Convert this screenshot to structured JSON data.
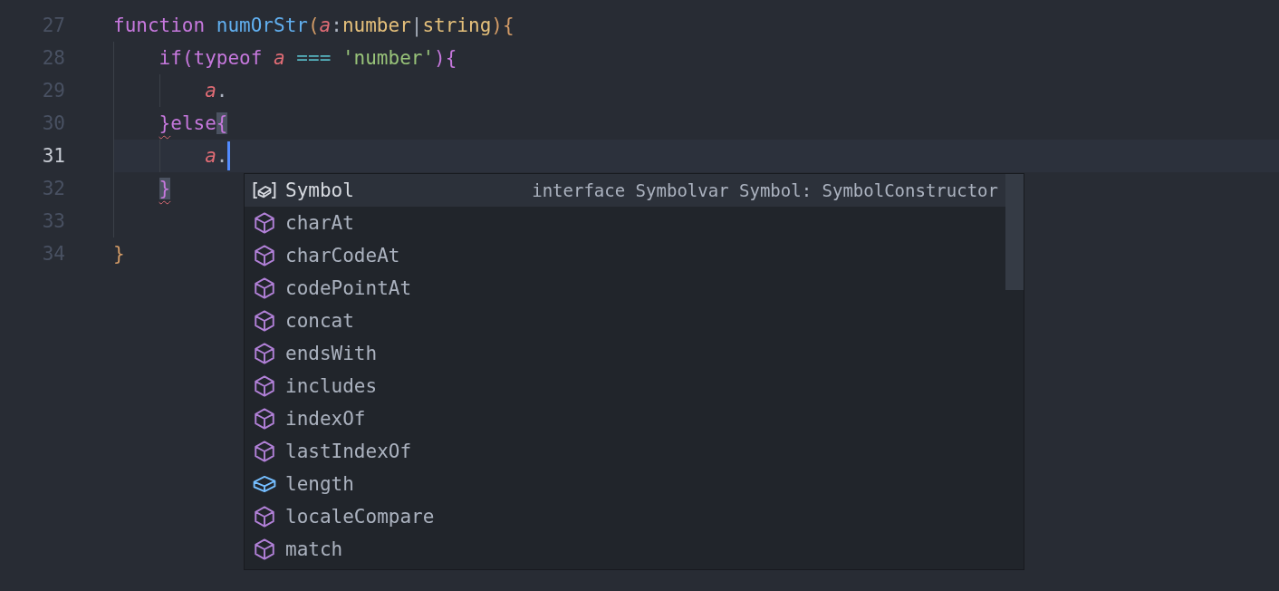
{
  "editor": {
    "lines": [
      {
        "number": "27",
        "current": false,
        "tokens": [
          {
            "text": "function ",
            "kind": "keyword"
          },
          {
            "text": "numOrStr",
            "kind": "function"
          },
          {
            "text": "(",
            "kind": "bracket1"
          },
          {
            "text": "a",
            "kind": "param"
          },
          {
            "text": ":",
            "kind": "punct"
          },
          {
            "text": "number",
            "kind": "type"
          },
          {
            "text": "|",
            "kind": "punct"
          },
          {
            "text": "string",
            "kind": "type"
          },
          {
            "text": ")",
            "kind": "bracket1"
          },
          {
            "text": "{",
            "kind": "bracket1"
          }
        ]
      },
      {
        "number": "28",
        "current": false,
        "tokens": [
          {
            "text": "    if",
            "kind": "keyword"
          },
          {
            "text": "(",
            "kind": "bracket2"
          },
          {
            "text": "typeof ",
            "kind": "keyword"
          },
          {
            "text": "a",
            "kind": "param"
          },
          {
            "text": " === ",
            "kind": "operator"
          },
          {
            "text": "'number'",
            "kind": "string"
          },
          {
            "text": ")",
            "kind": "bracket2"
          },
          {
            "text": "{",
            "kind": "bracket2"
          }
        ]
      },
      {
        "number": "29",
        "current": false,
        "tokens": [
          {
            "text": "        a",
            "kind": "param"
          },
          {
            "text": ".",
            "kind": "punct"
          }
        ]
      },
      {
        "number": "30",
        "current": false,
        "tokens": [
          {
            "text": "    }",
            "kind": "bracket2",
            "error": true
          },
          {
            "text": "else",
            "kind": "keyword"
          },
          {
            "text": "{",
            "kind": "bracket2",
            "matched": true
          }
        ]
      },
      {
        "number": "31",
        "current": true,
        "tokens": [
          {
            "text": "        a",
            "kind": "param"
          },
          {
            "text": ".",
            "kind": "punct"
          }
        ]
      },
      {
        "number": "32",
        "current": false,
        "tokens": [
          {
            "text": "    }",
            "kind": "bracket2",
            "error": true,
            "matched": true
          }
        ]
      },
      {
        "number": "33",
        "current": false
      },
      {
        "number": "34",
        "current": false,
        "tokens": [
          {
            "text": "}",
            "kind": "bracket1"
          }
        ]
      }
    ]
  },
  "suggestions": [
    {
      "label": "Symbol",
      "kind": "interface",
      "selected": true,
      "detail": "interface Symbolvar Symbol: SymbolConstructor"
    },
    {
      "label": "charAt",
      "kind": "method",
      "selected": false
    },
    {
      "label": "charCodeAt",
      "kind": "method",
      "selected": false
    },
    {
      "label": "codePointAt",
      "kind": "method",
      "selected": false
    },
    {
      "label": "concat",
      "kind": "method",
      "selected": false
    },
    {
      "label": "endsWith",
      "kind": "method",
      "selected": false
    },
    {
      "label": "includes",
      "kind": "method",
      "selected": false
    },
    {
      "label": "indexOf",
      "kind": "method",
      "selected": false
    },
    {
      "label": "lastIndexOf",
      "kind": "method",
      "selected": false
    },
    {
      "label": "length",
      "kind": "property",
      "selected": false
    },
    {
      "label": "localeCompare",
      "kind": "method",
      "selected": false
    },
    {
      "label": "match",
      "kind": "method",
      "selected": false
    }
  ]
}
